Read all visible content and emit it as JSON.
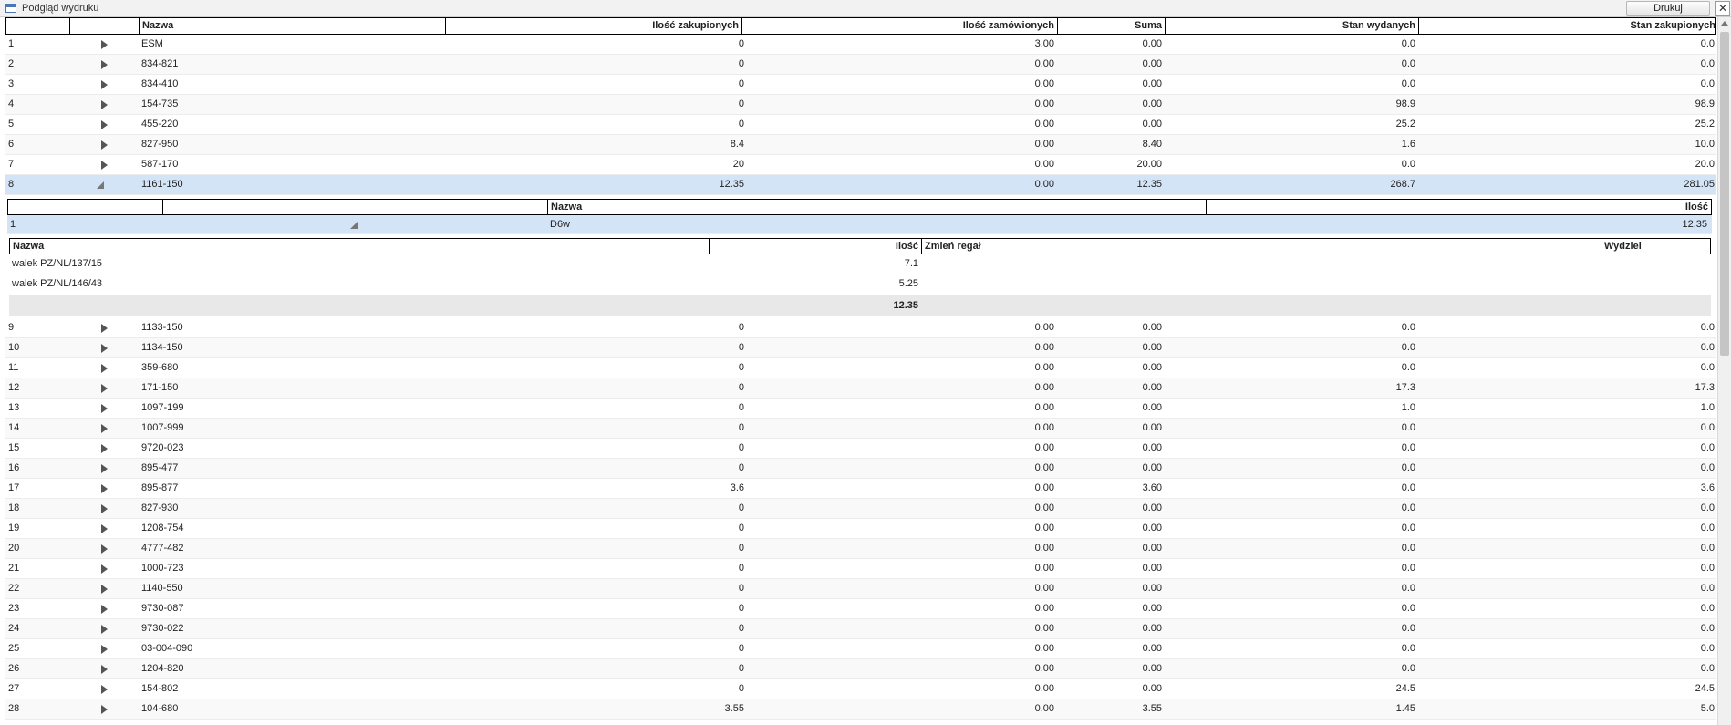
{
  "window": {
    "title": "Podgląd wydruku",
    "print_label": "Drukuj",
    "close_label": "✕"
  },
  "main": {
    "columns": [
      "",
      "",
      "Nazwa",
      "",
      "Ilość zakupionych",
      "Ilość zamówionych",
      "Suma",
      "Stan wydanych",
      "Stan zakupionych"
    ],
    "rows_top": [
      {
        "no": "1",
        "name": "ESM",
        "zak": "0",
        "zam": "3.00",
        "suma": "0.00",
        "wyd": "0.0",
        "stan": "0.0"
      },
      {
        "no": "2",
        "name": "834-821",
        "zak": "0",
        "zam": "0.00",
        "suma": "0.00",
        "wyd": "0.0",
        "stan": "0.0"
      },
      {
        "no": "3",
        "name": "834-410",
        "zak": "0",
        "zam": "0.00",
        "suma": "0.00",
        "wyd": "0.0",
        "stan": "0.0"
      },
      {
        "no": "4",
        "name": "154-735",
        "zak": "0",
        "zam": "0.00",
        "suma": "0.00",
        "wyd": "98.9",
        "stan": "98.9"
      },
      {
        "no": "5",
        "name": "455-220",
        "zak": "0",
        "zam": "0.00",
        "suma": "0.00",
        "wyd": "25.2",
        "stan": "25.2"
      },
      {
        "no": "6",
        "name": "827-950",
        "zak": "8.4",
        "zam": "0.00",
        "suma": "8.40",
        "wyd": "1.6",
        "stan": "10.0"
      },
      {
        "no": "7",
        "name": "587-170",
        "zak": "20",
        "zam": "0.00",
        "suma": "20.00",
        "wyd": "0.0",
        "stan": "20.0"
      }
    ],
    "expanded_row": {
      "no": "8",
      "name": "1161-150",
      "zak": "12.35",
      "zam": "0.00",
      "suma": "12.35",
      "wyd": "268.7",
      "stan": "281.05"
    },
    "rows_bottom": [
      {
        "no": "9",
        "name": "1133-150",
        "zak": "0",
        "zam": "0.00",
        "suma": "0.00",
        "wyd": "0.0",
        "stan": "0.0"
      },
      {
        "no": "10",
        "name": "1134-150",
        "zak": "0",
        "zam": "0.00",
        "suma": "0.00",
        "wyd": "0.0",
        "stan": "0.0"
      },
      {
        "no": "11",
        "name": "359-680",
        "zak": "0",
        "zam": "0.00",
        "suma": "0.00",
        "wyd": "0.0",
        "stan": "0.0"
      },
      {
        "no": "12",
        "name": "171-150",
        "zak": "0",
        "zam": "0.00",
        "suma": "0.00",
        "wyd": "17.3",
        "stan": "17.3"
      },
      {
        "no": "13",
        "name": "1097-199",
        "zak": "0",
        "zam": "0.00",
        "suma": "0.00",
        "wyd": "1.0",
        "stan": "1.0"
      },
      {
        "no": "14",
        "name": "1007-999",
        "zak": "0",
        "zam": "0.00",
        "suma": "0.00",
        "wyd": "0.0",
        "stan": "0.0"
      },
      {
        "no": "15",
        "name": "9720-023",
        "zak": "0",
        "zam": "0.00",
        "suma": "0.00",
        "wyd": "0.0",
        "stan": "0.0"
      },
      {
        "no": "16",
        "name": "895-477",
        "zak": "0",
        "zam": "0.00",
        "suma": "0.00",
        "wyd": "0.0",
        "stan": "0.0"
      },
      {
        "no": "17",
        "name": "895-877",
        "zak": "3.6",
        "zam": "0.00",
        "suma": "3.60",
        "wyd": "0.0",
        "stan": "3.6"
      },
      {
        "no": "18",
        "name": "827-930",
        "zak": "0",
        "zam": "0.00",
        "suma": "0.00",
        "wyd": "0.0",
        "stan": "0.0"
      },
      {
        "no": "19",
        "name": "1208-754",
        "zak": "0",
        "zam": "0.00",
        "suma": "0.00",
        "wyd": "0.0",
        "stan": "0.0"
      },
      {
        "no": "20",
        "name": "4777-482",
        "zak": "0",
        "zam": "0.00",
        "suma": "0.00",
        "wyd": "0.0",
        "stan": "0.0"
      },
      {
        "no": "21",
        "name": "1000-723",
        "zak": "0",
        "zam": "0.00",
        "suma": "0.00",
        "wyd": "0.0",
        "stan": "0.0"
      },
      {
        "no": "22",
        "name": "1140-550",
        "zak": "0",
        "zam": "0.00",
        "suma": "0.00",
        "wyd": "0.0",
        "stan": "0.0"
      },
      {
        "no": "23",
        "name": "9730-087",
        "zak": "0",
        "zam": "0.00",
        "suma": "0.00",
        "wyd": "0.0",
        "stan": "0.0"
      },
      {
        "no": "24",
        "name": "9730-022",
        "zak": "0",
        "zam": "0.00",
        "suma": "0.00",
        "wyd": "0.0",
        "stan": "0.0"
      },
      {
        "no": "25",
        "name": "03-004-090",
        "zak": "0",
        "zam": "0.00",
        "suma": "0.00",
        "wyd": "0.0",
        "stan": "0.0"
      },
      {
        "no": "26",
        "name": "1204-820",
        "zak": "0",
        "zam": "0.00",
        "suma": "0.00",
        "wyd": "0.0",
        "stan": "0.0"
      },
      {
        "no": "27",
        "name": "154-802",
        "zak": "0",
        "zam": "0.00",
        "suma": "0.00",
        "wyd": "24.5",
        "stan": "24.5"
      },
      {
        "no": "28",
        "name": "104-680",
        "zak": "3.55",
        "zam": "0.00",
        "suma": "3.55",
        "wyd": "1.45",
        "stan": "5.0"
      }
    ]
  },
  "sub1": {
    "columns": [
      "",
      "",
      "Nazwa",
      "Ilość"
    ],
    "row": {
      "no": "1",
      "name": "D6w",
      "qty": "12.35"
    }
  },
  "sub2": {
    "columns": [
      "Nazwa",
      "Ilość",
      "Zmień regał",
      "Wydziel"
    ],
    "rows": [
      {
        "name": "walek PZ/NL/137/15",
        "qty": "7.1"
      },
      {
        "name": "walek PZ/NL/146/43",
        "qty": "5.25"
      }
    ],
    "total": "12.35"
  },
  "colors": {
    "selected_row": "#d4e4f7",
    "header_border": "#000000",
    "scroll_thumb": "#c5c5c5"
  }
}
